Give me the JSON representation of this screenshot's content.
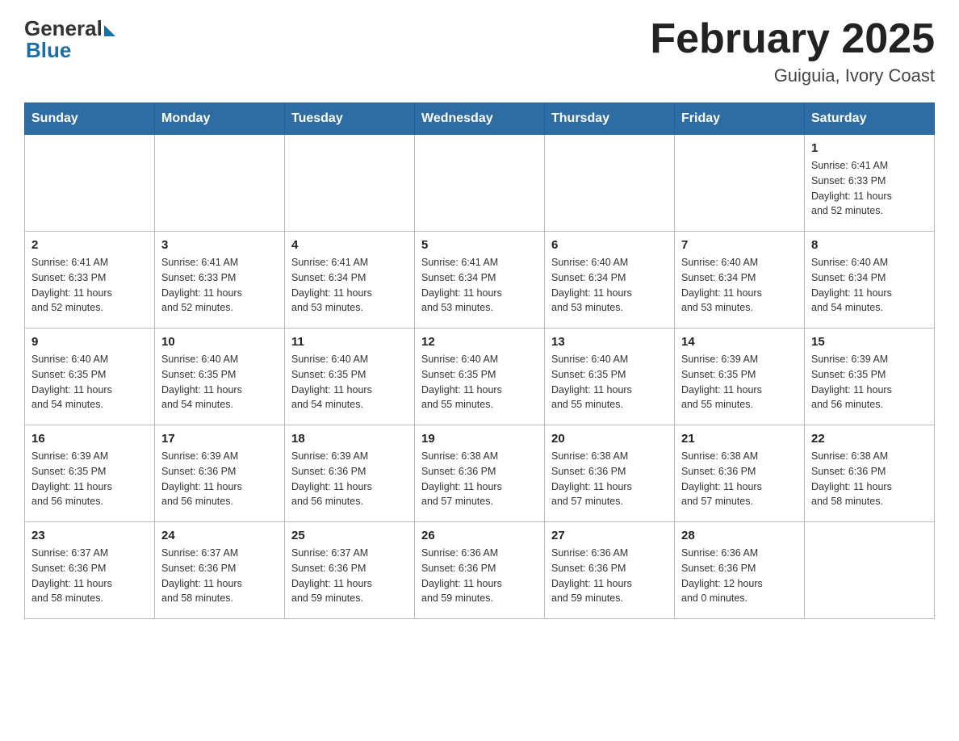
{
  "header": {
    "logo_general": "General",
    "logo_blue": "Blue",
    "month_title": "February 2025",
    "location": "Guiguia, Ivory Coast"
  },
  "days_of_week": [
    "Sunday",
    "Monday",
    "Tuesday",
    "Wednesday",
    "Thursday",
    "Friday",
    "Saturday"
  ],
  "weeks": [
    [
      {
        "day": "",
        "info": "",
        "empty": true
      },
      {
        "day": "",
        "info": "",
        "empty": true
      },
      {
        "day": "",
        "info": "",
        "empty": true
      },
      {
        "day": "",
        "info": "",
        "empty": true
      },
      {
        "day": "",
        "info": "",
        "empty": true
      },
      {
        "day": "",
        "info": "",
        "empty": true
      },
      {
        "day": "1",
        "info": "Sunrise: 6:41 AM\nSunset: 6:33 PM\nDaylight: 11 hours\nand 52 minutes."
      }
    ],
    [
      {
        "day": "2",
        "info": "Sunrise: 6:41 AM\nSunset: 6:33 PM\nDaylight: 11 hours\nand 52 minutes."
      },
      {
        "day": "3",
        "info": "Sunrise: 6:41 AM\nSunset: 6:33 PM\nDaylight: 11 hours\nand 52 minutes."
      },
      {
        "day": "4",
        "info": "Sunrise: 6:41 AM\nSunset: 6:34 PM\nDaylight: 11 hours\nand 53 minutes."
      },
      {
        "day": "5",
        "info": "Sunrise: 6:41 AM\nSunset: 6:34 PM\nDaylight: 11 hours\nand 53 minutes."
      },
      {
        "day": "6",
        "info": "Sunrise: 6:40 AM\nSunset: 6:34 PM\nDaylight: 11 hours\nand 53 minutes."
      },
      {
        "day": "7",
        "info": "Sunrise: 6:40 AM\nSunset: 6:34 PM\nDaylight: 11 hours\nand 53 minutes."
      },
      {
        "day": "8",
        "info": "Sunrise: 6:40 AM\nSunset: 6:34 PM\nDaylight: 11 hours\nand 54 minutes."
      }
    ],
    [
      {
        "day": "9",
        "info": "Sunrise: 6:40 AM\nSunset: 6:35 PM\nDaylight: 11 hours\nand 54 minutes."
      },
      {
        "day": "10",
        "info": "Sunrise: 6:40 AM\nSunset: 6:35 PM\nDaylight: 11 hours\nand 54 minutes."
      },
      {
        "day": "11",
        "info": "Sunrise: 6:40 AM\nSunset: 6:35 PM\nDaylight: 11 hours\nand 54 minutes."
      },
      {
        "day": "12",
        "info": "Sunrise: 6:40 AM\nSunset: 6:35 PM\nDaylight: 11 hours\nand 55 minutes."
      },
      {
        "day": "13",
        "info": "Sunrise: 6:40 AM\nSunset: 6:35 PM\nDaylight: 11 hours\nand 55 minutes."
      },
      {
        "day": "14",
        "info": "Sunrise: 6:39 AM\nSunset: 6:35 PM\nDaylight: 11 hours\nand 55 minutes."
      },
      {
        "day": "15",
        "info": "Sunrise: 6:39 AM\nSunset: 6:35 PM\nDaylight: 11 hours\nand 56 minutes."
      }
    ],
    [
      {
        "day": "16",
        "info": "Sunrise: 6:39 AM\nSunset: 6:35 PM\nDaylight: 11 hours\nand 56 minutes."
      },
      {
        "day": "17",
        "info": "Sunrise: 6:39 AM\nSunset: 6:36 PM\nDaylight: 11 hours\nand 56 minutes."
      },
      {
        "day": "18",
        "info": "Sunrise: 6:39 AM\nSunset: 6:36 PM\nDaylight: 11 hours\nand 56 minutes."
      },
      {
        "day": "19",
        "info": "Sunrise: 6:38 AM\nSunset: 6:36 PM\nDaylight: 11 hours\nand 57 minutes."
      },
      {
        "day": "20",
        "info": "Sunrise: 6:38 AM\nSunset: 6:36 PM\nDaylight: 11 hours\nand 57 minutes."
      },
      {
        "day": "21",
        "info": "Sunrise: 6:38 AM\nSunset: 6:36 PM\nDaylight: 11 hours\nand 57 minutes."
      },
      {
        "day": "22",
        "info": "Sunrise: 6:38 AM\nSunset: 6:36 PM\nDaylight: 11 hours\nand 58 minutes."
      }
    ],
    [
      {
        "day": "23",
        "info": "Sunrise: 6:37 AM\nSunset: 6:36 PM\nDaylight: 11 hours\nand 58 minutes."
      },
      {
        "day": "24",
        "info": "Sunrise: 6:37 AM\nSunset: 6:36 PM\nDaylight: 11 hours\nand 58 minutes."
      },
      {
        "day": "25",
        "info": "Sunrise: 6:37 AM\nSunset: 6:36 PM\nDaylight: 11 hours\nand 59 minutes."
      },
      {
        "day": "26",
        "info": "Sunrise: 6:36 AM\nSunset: 6:36 PM\nDaylight: 11 hours\nand 59 minutes."
      },
      {
        "day": "27",
        "info": "Sunrise: 6:36 AM\nSunset: 6:36 PM\nDaylight: 11 hours\nand 59 minutes."
      },
      {
        "day": "28",
        "info": "Sunrise: 6:36 AM\nSunset: 6:36 PM\nDaylight: 12 hours\nand 0 minutes."
      },
      {
        "day": "",
        "info": "",
        "empty": true
      }
    ]
  ]
}
